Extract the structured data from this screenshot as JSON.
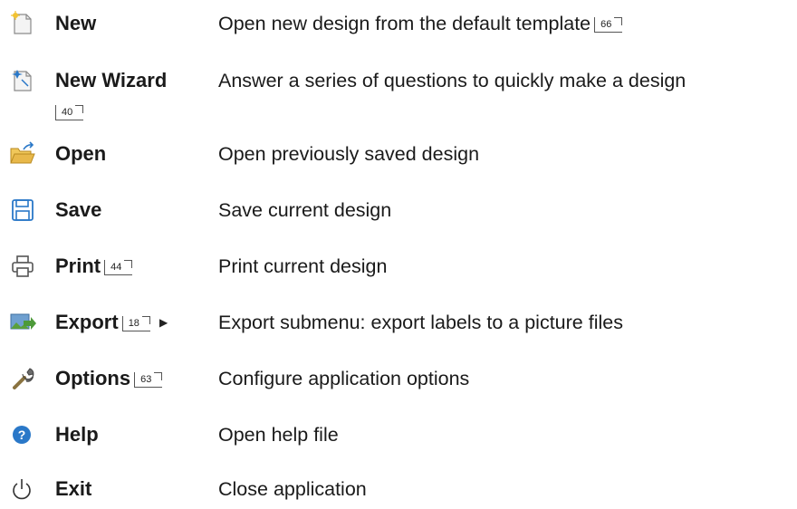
{
  "items": [
    {
      "name": "New",
      "ref": "",
      "description": "Open new design from the default template",
      "desc_ref": "66",
      "icon": "new-document-icon"
    },
    {
      "name": "New Wizard",
      "ref": "",
      "description": "Answer a series of questions to quickly make a design",
      "wrap_ref": "40",
      "icon": "wizard-document-icon"
    },
    {
      "name": "Open",
      "ref": "",
      "description": "Open previously saved design",
      "icon": "open-folder-icon"
    },
    {
      "name": "Save",
      "ref": "",
      "description": "Save current design",
      "icon": "save-floppy-icon"
    },
    {
      "name": "Print",
      "ref": "44",
      "description": "Print current design",
      "icon": "printer-icon"
    },
    {
      "name": "Export",
      "ref": "18",
      "description": "Export submenu: export labels to a picture files",
      "icon": "export-picture-icon"
    },
    {
      "name": "Options",
      "ref": "63",
      "description": "Configure application options",
      "icon": "wrench-icon"
    },
    {
      "name": "Help",
      "ref": "",
      "description": "Open help file",
      "icon": "help-icon"
    },
    {
      "name": "Exit",
      "ref": "",
      "description": "Close application",
      "icon": "power-icon"
    }
  ],
  "colors": {
    "accent_blue": "#2a78c8",
    "folder_yellow": "#e8b84a",
    "export_green": "#5aa03c"
  }
}
